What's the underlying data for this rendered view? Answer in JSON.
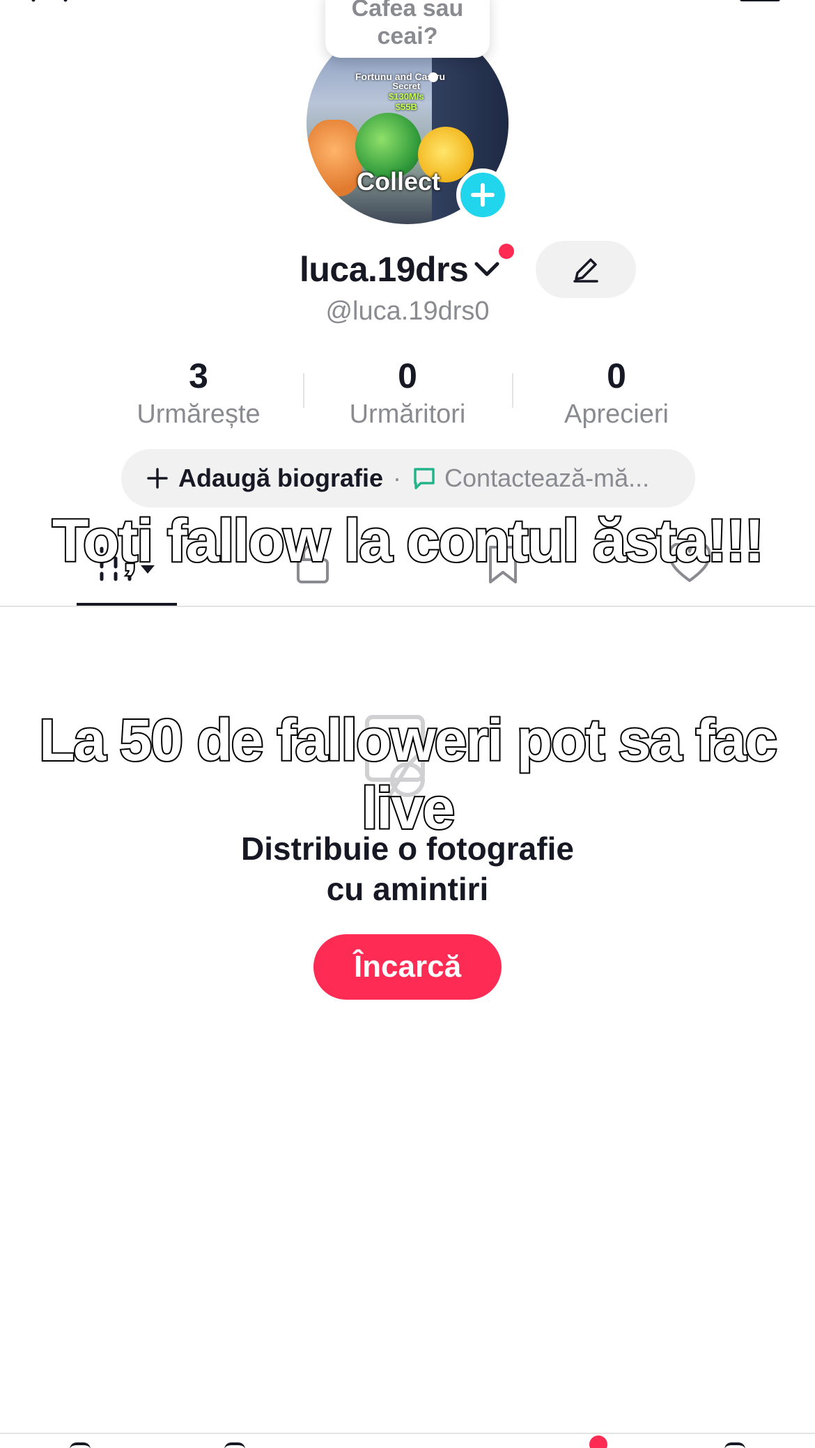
{
  "status_bubble": {
    "text": "Cafea sau\nceai?"
  },
  "avatar": {
    "overlay_text_1": "Fortunu and Cas ru",
    "overlay_text_2": "Secret",
    "overlay_text_3": "$130M/s",
    "overlay_text_4": "$55B",
    "overlay_text_5": "Collect"
  },
  "profile": {
    "display_name": "luca.19drs",
    "handle": "@luca.19drs0"
  },
  "stats": [
    {
      "value": "3",
      "label": "Urmărește"
    },
    {
      "value": "0",
      "label": "Urmăritori"
    },
    {
      "value": "0",
      "label": "Aprecieri"
    }
  ],
  "bio": {
    "add_label": "Adaugă biografie",
    "separator": "·",
    "contact_label": "Contactează-mă..."
  },
  "empty_state": {
    "message": "Distribuie o fotografie\ncu amintiri",
    "upload_label": "Încarcă"
  },
  "captions": {
    "line_1": "Toți fallow la contul ăsta!!!",
    "line_2": "La 50 de falloweri pot sa fac live"
  },
  "colors": {
    "accent": "#fe2c55",
    "cyan": "#20d5ec",
    "text_primary": "#161823",
    "text_secondary": "#8a8b91",
    "pill_bg": "#f1f1f2",
    "contact_icon": "#25b38a"
  }
}
